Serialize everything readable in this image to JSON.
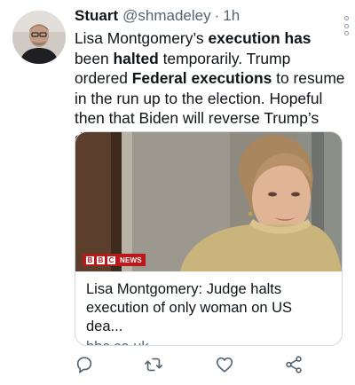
{
  "author": {
    "name": "Stuart",
    "handle": "@shmadeley",
    "separator": "·",
    "time": "1h"
  },
  "tweet": {
    "segments": [
      {
        "text": "Lisa Montgomery’s ",
        "bold": false
      },
      {
        "text": "execution has",
        "bold": true
      },
      {
        "text": " been ",
        "bold": false
      },
      {
        "text": "halted",
        "bold": true
      },
      {
        "text": " temporarily. Trump ordered ",
        "bold": false
      },
      {
        "text": "Federal executions",
        "bold": true
      },
      {
        "text": " to resume in the run up to the election. Hopeful then that Biden will reverse Trump’s decision.",
        "bold": false
      }
    ]
  },
  "card": {
    "badge_letters": [
      "B",
      "B",
      "C"
    ],
    "badge_label": "NEWS",
    "title": "Lisa Montgomery: Judge halts execution of only woman on US dea...",
    "domain": "bbc.co.uk"
  },
  "icons": {
    "reply": "reply-icon",
    "retweet": "retweet-icon",
    "like": "like-icon",
    "share": "share-icon",
    "more": "more-options-icon"
  },
  "colors": {
    "text": "#0f1419",
    "secondary": "#536471",
    "border": "#cfd9de",
    "bbc_red": "#bb1919"
  }
}
